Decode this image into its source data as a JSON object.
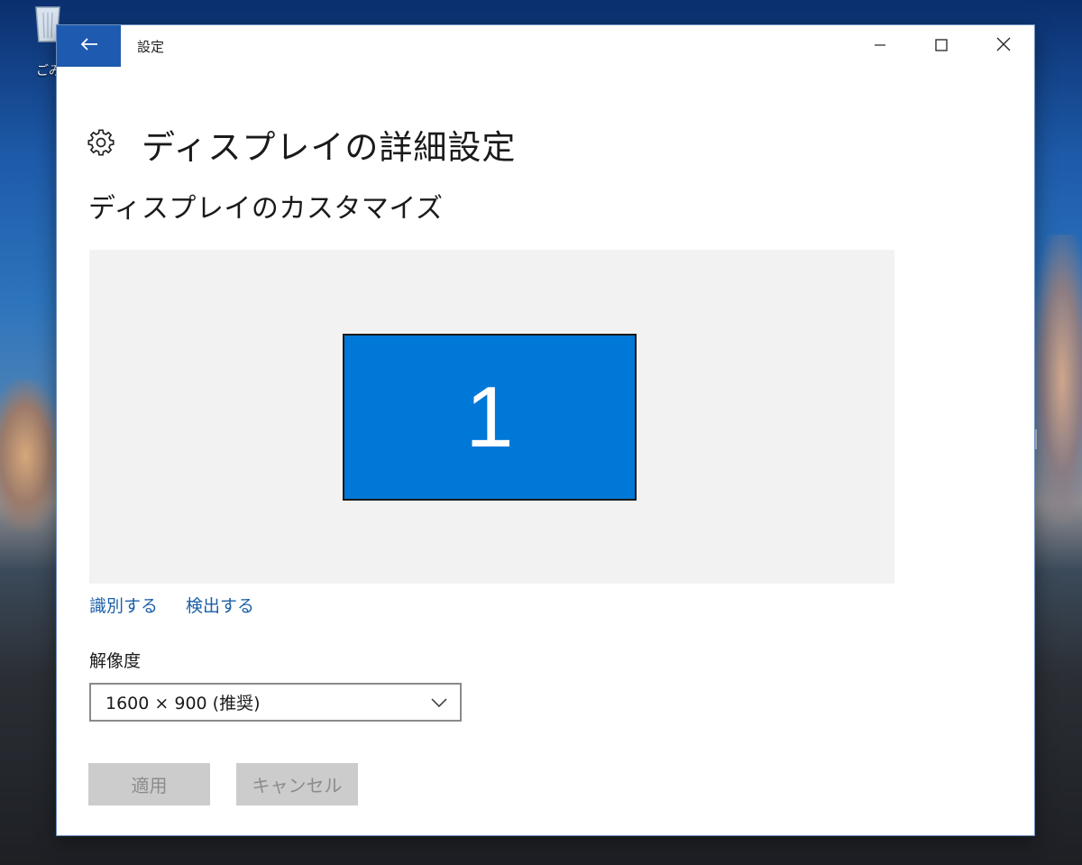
{
  "desktop": {
    "recycle_bin_label": "ごみ"
  },
  "window": {
    "title": "設定",
    "back_icon": "back-arrow-icon",
    "minimize_icon": "minimize-icon",
    "maximize_icon": "maximize-icon",
    "close_icon": "close-icon"
  },
  "page": {
    "icon": "gear-icon",
    "title": "ディスプレイの詳細設定",
    "section_title": "ディスプレイのカスタマイズ"
  },
  "display_arrangement": {
    "monitor_number": "1",
    "accent_color": "#0078d7",
    "background_color": "#f2f2f2"
  },
  "links": {
    "identify": "識別する",
    "detect": "検出する"
  },
  "resolution": {
    "label": "解像度",
    "selected": "1600 × 900 (推奨)"
  },
  "buttons": {
    "apply": "適用",
    "cancel": "キャンセル"
  }
}
